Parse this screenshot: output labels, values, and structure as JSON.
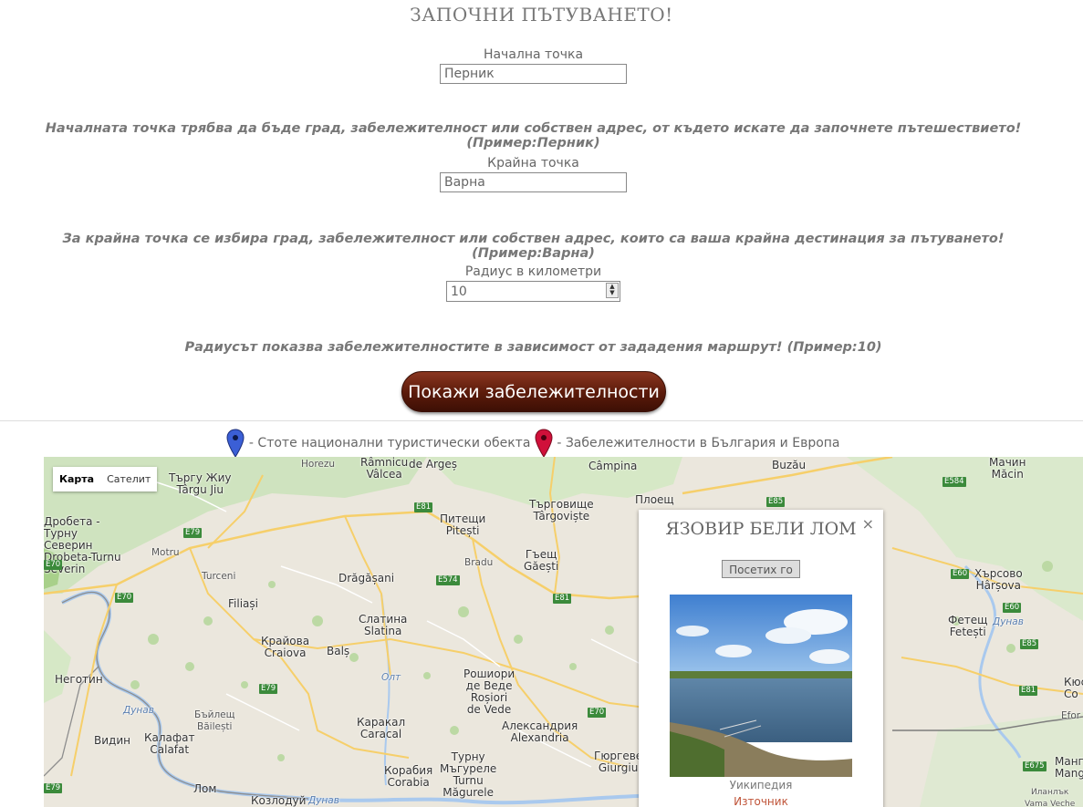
{
  "page": {
    "title": "ЗАПОЧНИ ПЪТУВАНЕТО!"
  },
  "form": {
    "start_label": "Начална точка",
    "start_value": "Перник",
    "start_hint": "Началната точка трябва да бъде град, забележителност или собствен адрес, от където искате да започнете пътешествието! (Пример:Перник)",
    "end_label": "Крайна точка",
    "end_value": "Варна",
    "end_hint": "За крайна точка се избира град, забележителност или собствен адрес, които са ваша крайна дестинация за пътуването! (Пример:Варна)",
    "radius_label": "Радиус в километри",
    "radius_value": "10",
    "radius_hint": "Радиусът показва забележителностите в зависимост от зададения маршрут! (Пример:10)",
    "submit_label": "Покажи забележителности"
  },
  "legend": {
    "blue_text": "- Стоте национални туристически обекта",
    "red_text": "- Забележителности в България и Европа",
    "blue_color": "#3b5fd6",
    "red_color": "#d0103a"
  },
  "map": {
    "type_controls": [
      "Карта",
      "Сателит"
    ],
    "active_type": "Карта",
    "places": {
      "targu_jiu": "Търгу Жиу\nTârgu Jiu",
      "ramnicu": "Râmnicu\nVâlcea",
      "horezu": "Horezu",
      "arges": "de Argeș",
      "campina": "Câmpina",
      "buzau": "Buzău",
      "machin": "Мачин\nMăcin",
      "drobeta": "Дробета -\nТурну\nСеверин\nDrobeta-Turnu\nSeverin",
      "motru": "Motru",
      "pitesti": "Питещи\nPitești",
      "bradu": "Bradu",
      "targoviste": "Търговище\nTârgoviște",
      "ploiesti": "Плоещ",
      "gaesti": "Гъещ\nGăești",
      "turceni": "Turceni",
      "dragasani": "Drăgășani",
      "filiasi": "Filiași",
      "slatina": "Слатина\nSlatina",
      "craiova": "Крайова\nCraiova",
      "bals": "Balș",
      "negotin": "Неготин",
      "rosiori": "Рошиори\nде Веде\nRoșiori\nde Vede",
      "bailesti": "Бъйлещ\nBăilești",
      "caracal": "Каракал\nCaracal",
      "kalafat": "Калафат\nCalafat",
      "vidin": "Видин",
      "alexandria": "Александрия\nAlexandria",
      "corabia": "Корабия\nCorabia",
      "turnu": "Турну\nМъгуреле\nTurnu\nMăgurele",
      "giurgiu": "Гюргеве\nGiurgiu",
      "lom": "Лом",
      "kozloduy": "Козлодуй",
      "harsovo": "Хърсово\nHârșova",
      "fetesti": "Фетещ\nFetești",
      "kyus": "Кюс\nCo",
      "efor": "Efor",
      "mang": "Манг\nMang",
      "ilanlak": "Иланлък\nVama Veche",
      "olt": "Олт",
      "dunav1": "Дунав",
      "dunav2": "Дунав",
      "dunav3": "Дунав"
    },
    "roads": [
      "E79",
      "E79",
      "E81",
      "E574",
      "E81",
      "E70",
      "E70",
      "E70",
      "E79",
      "E85",
      "E584",
      "E60",
      "E60",
      "E81",
      "E675",
      "E85"
    ]
  },
  "popup": {
    "title": "ЯЗОВИР БЕЛИ ЛОМ",
    "close": "×",
    "visited_button": "Посетих го",
    "source_name": "Уикипедия",
    "source_link": "Източник"
  }
}
